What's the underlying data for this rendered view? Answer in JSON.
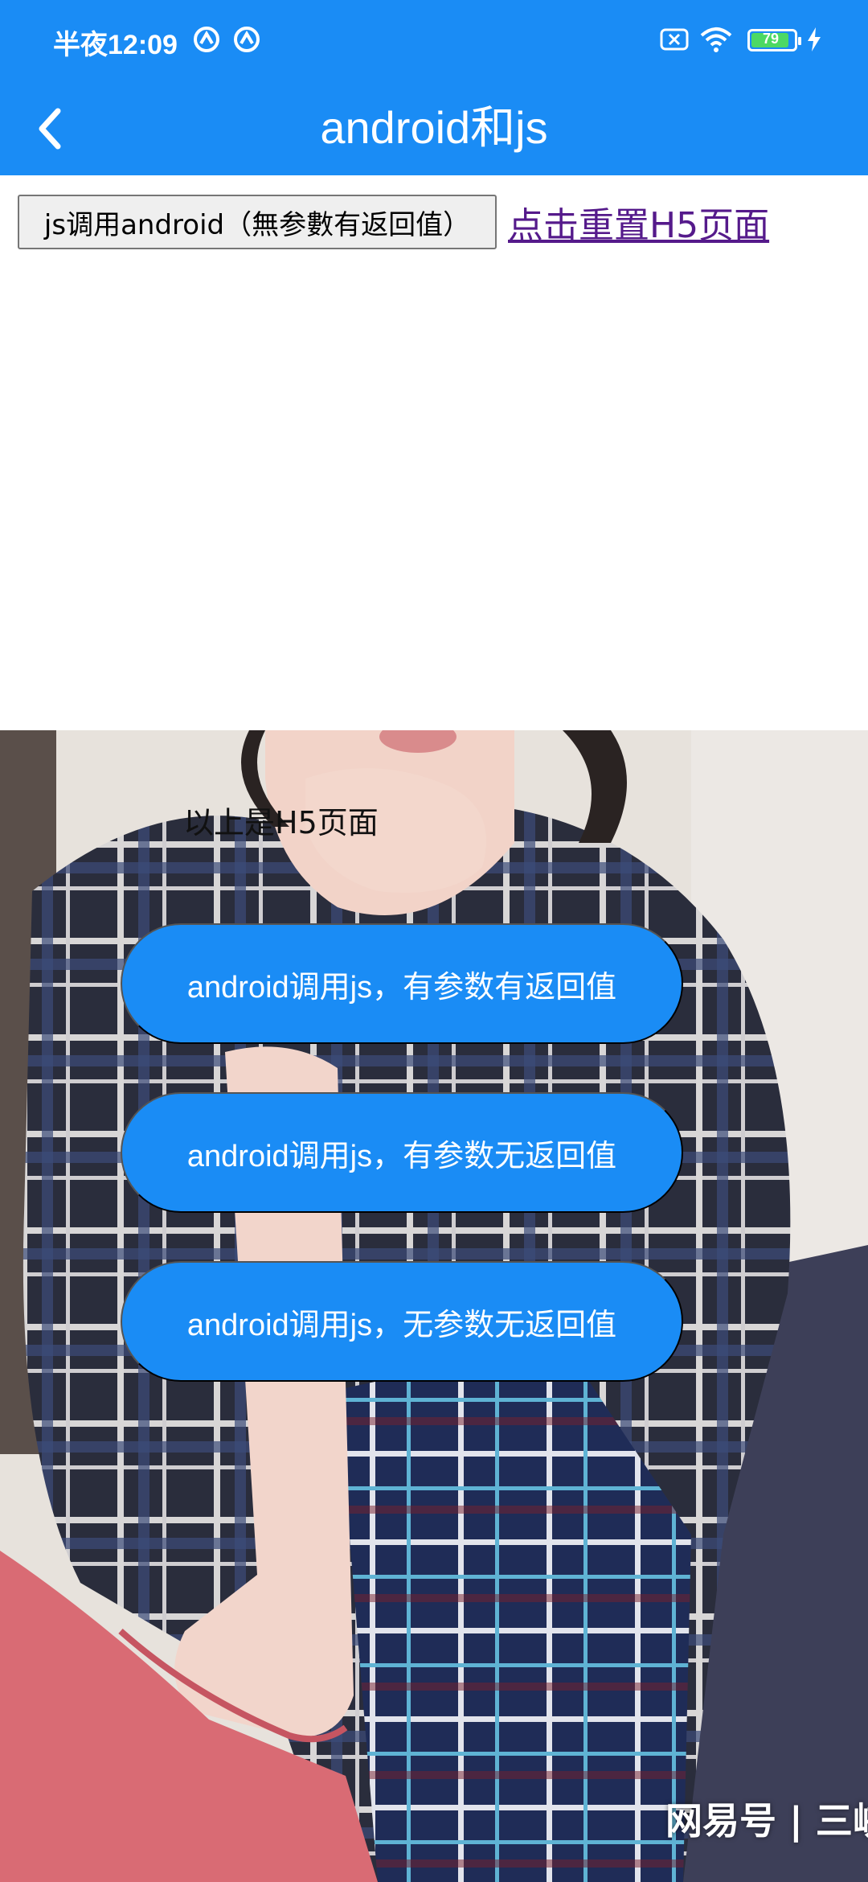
{
  "status_bar": {
    "time": "半夜12:09",
    "battery": "79",
    "icons": [
      "nfc-icon",
      "nfc-icon",
      "sim-off-icon",
      "wifi-icon",
      "battery-icon",
      "charging-icon"
    ]
  },
  "header": {
    "title": "android和js",
    "back_icon": "chevron-left-icon"
  },
  "webview": {
    "button_label": "js调用android（無参數有返回值）",
    "reset_link": "点击重置H5页面"
  },
  "native": {
    "caption": "以上是H5页面",
    "buttons": [
      {
        "label": "android调用js，有参数有返回值"
      },
      {
        "label": "android调用js，有参数无返回值"
      },
      {
        "label": "android调用js，无参数无返回值"
      }
    ],
    "watermark": "网易号 | 三峡"
  },
  "colors": {
    "accent": "#1a8cf5",
    "link": "#551a8b"
  }
}
